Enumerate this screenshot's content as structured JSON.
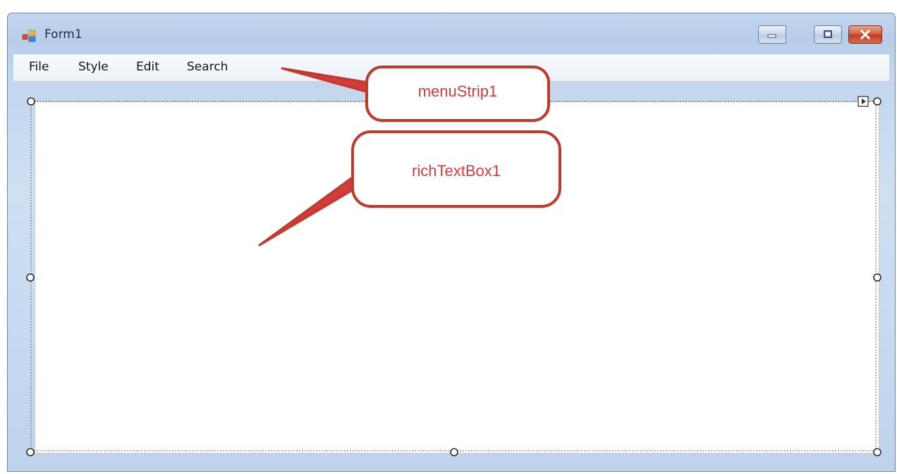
{
  "window": {
    "title": "Form1",
    "icon": "form-app-icon",
    "caption_buttons": [
      "minimize-icon",
      "maximize-icon",
      "close-icon"
    ]
  },
  "menu": {
    "items": [
      {
        "label": "File"
      },
      {
        "label": "Style"
      },
      {
        "label": "Edit"
      },
      {
        "label": "Search"
      }
    ]
  },
  "annotations": {
    "menustrip": "menuStrip1",
    "richtextbox": "richTextBox1",
    "color": "#d23c3c"
  },
  "colors": {
    "window_frame": "#c3d6ee",
    "close_button": "#c13a1f",
    "callout_stroke": "#d23c3c"
  }
}
